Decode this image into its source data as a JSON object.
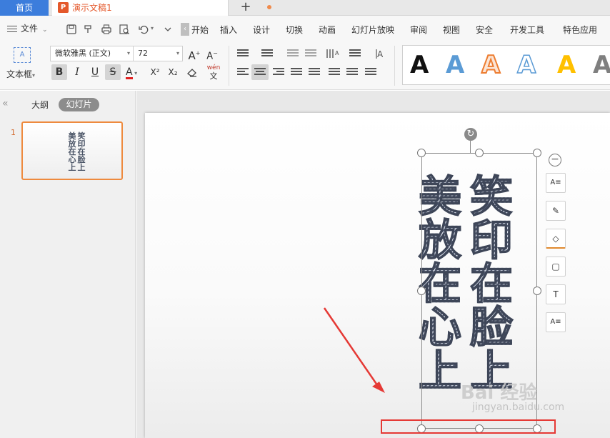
{
  "tabs": {
    "home": "首页",
    "document": "演示文稿1",
    "add": "+"
  },
  "menubar": {
    "file": "文件",
    "collapse": "‹",
    "items": [
      "开始",
      "插入",
      "设计",
      "切换",
      "动画",
      "幻灯片放映",
      "审阅",
      "视图",
      "安全",
      "开发工具",
      "特色应用"
    ]
  },
  "ribbon": {
    "textbox_label": "文本框",
    "textbox_icon_text": "A",
    "font_name": "微软雅黑 (正文)",
    "font_size": "72",
    "grow_font": "A",
    "shrink_font": "A",
    "bold": "B",
    "italic": "I",
    "underline": "U",
    "strikethrough": "S",
    "font_color": "A",
    "superscript": "X²",
    "subscript": "X₂",
    "phonetic": "wén",
    "wordart_samples": [
      {
        "letter": "A",
        "color": "#111111"
      },
      {
        "letter": "A",
        "color": "#5b9bd5"
      },
      {
        "letter": "A",
        "color": "#ed7d31"
      },
      {
        "letter": "A",
        "color": "#5b9bd5"
      },
      {
        "letter": "A",
        "color": "#ffc000"
      },
      {
        "letter": "A",
        "color": "#7f7f7f"
      }
    ]
  },
  "left_panel": {
    "collapse": "«",
    "tab_outline": "大纲",
    "tab_slides": "幻灯片",
    "slide_number": "1",
    "thumb_col1": "笑印在脸上",
    "thumb_col2": "美放在心上"
  },
  "slide": {
    "column_right": [
      "笑",
      "印",
      "在",
      "脸",
      "上"
    ],
    "column_left": [
      "美",
      "放",
      "在",
      "心",
      "上"
    ]
  },
  "float_tools": {
    "minus": "−",
    "items": [
      "A≡",
      "✎",
      "◇",
      "▢",
      "T",
      "A≡"
    ]
  },
  "watermark": {
    "brand": "Bai 经验",
    "url": "jingyan.baidu.com"
  },
  "colors": {
    "accent_blue": "#3c7ddc",
    "doc_orange": "#e4582b",
    "selection_orange": "#ee8a3e",
    "annotation_red": "#e53935"
  }
}
